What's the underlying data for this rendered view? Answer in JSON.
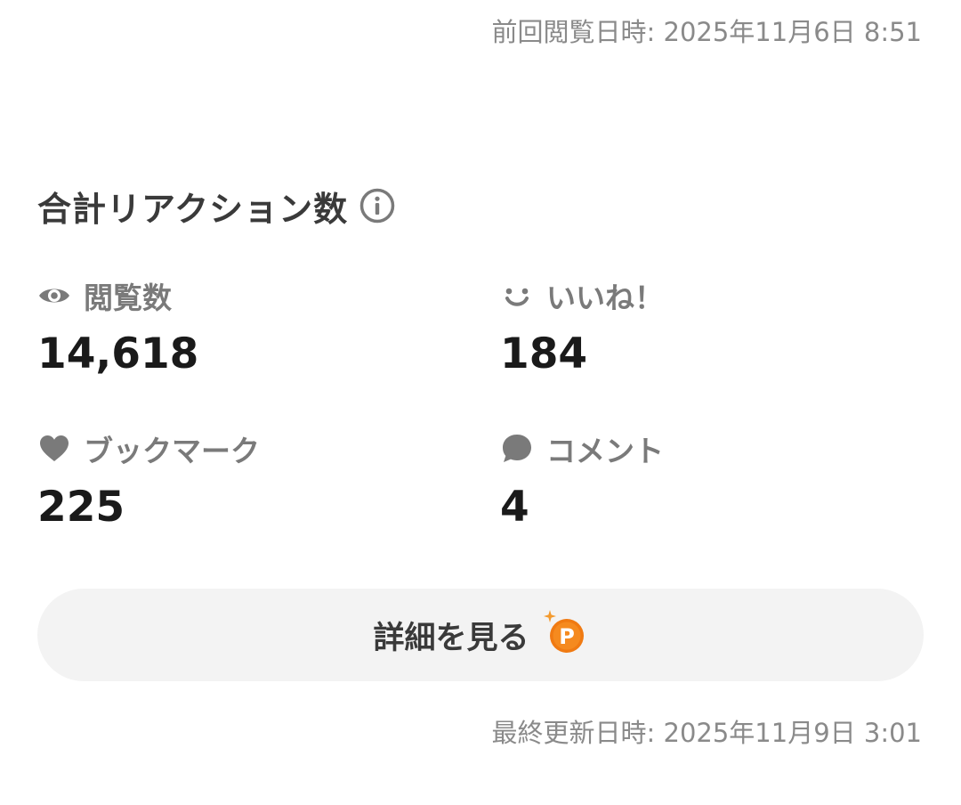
{
  "header": {
    "last_viewed": "前回閲覧日時: 2025年11月6日 8:51"
  },
  "reactions": {
    "title": "合計リアクション数",
    "info_icon": "info-icon",
    "stats": {
      "views": {
        "label": "閲覧数",
        "value": "14,618",
        "icon": "eye-icon"
      },
      "likes": {
        "label": "いいね！",
        "value": "184",
        "icon": "smile-icon"
      },
      "bookmarks": {
        "label": "ブックマーク",
        "value": "225",
        "icon": "heart-icon"
      },
      "comments": {
        "label": "コメント",
        "value": "4",
        "icon": "speech-bubble-icon"
      }
    }
  },
  "details_button": {
    "label": "詳細を見る",
    "icon": "points-icon",
    "icon_text": "P"
  },
  "footer": {
    "last_updated": "最終更新日時: 2025年11月9日 3:01"
  },
  "colors": {
    "label_gray": "#7a7a7a",
    "meta_gray": "#8a8a8a",
    "value_black": "#1a1a1a",
    "button_bg": "#f3f3f3",
    "points_orange": "#f07a12"
  }
}
